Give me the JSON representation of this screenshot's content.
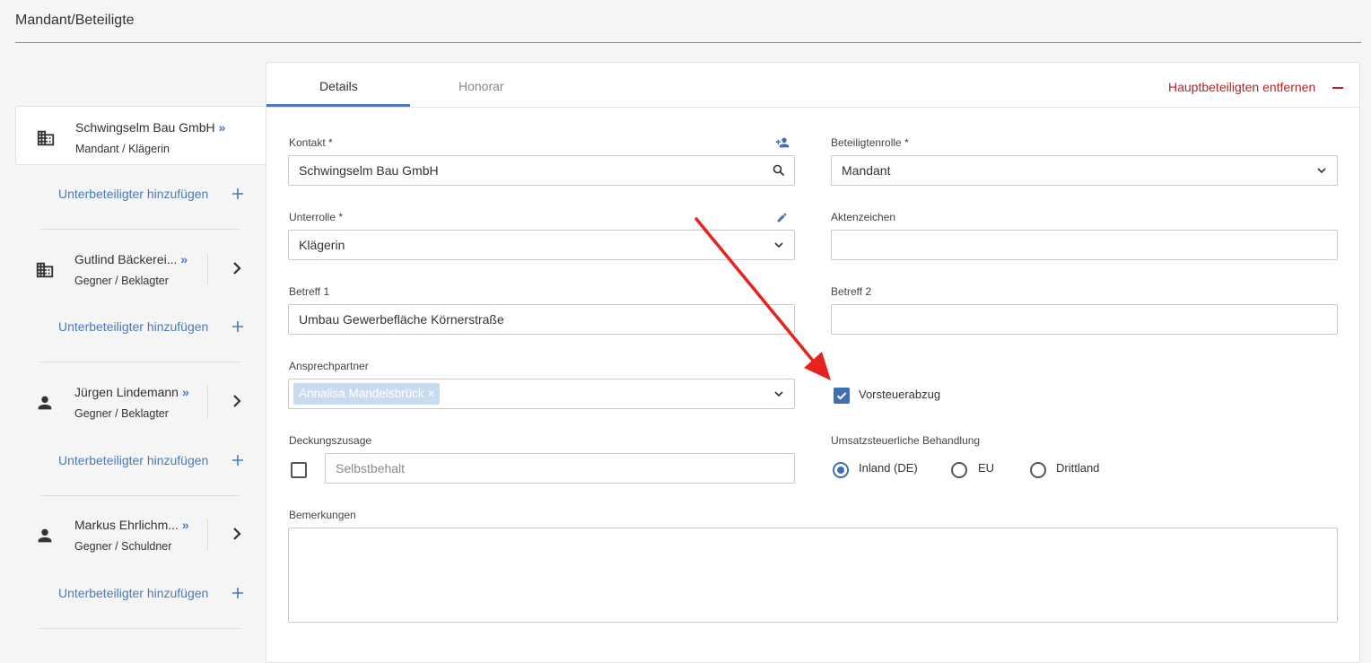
{
  "page": {
    "title": "Mandant/Beteiligte"
  },
  "sidebar": {
    "add_sub_label": "Unterbeteiligter hinzufügen",
    "parties": [
      {
        "name": "Schwingselm Bau GmbH",
        "role": "Mandant / Klägerin",
        "icon": "building-icon",
        "active": true
      },
      {
        "name": "Gutlind Bäckerei...",
        "role": "Gegner / Beklagter",
        "icon": "building-icon",
        "active": false
      },
      {
        "name": "Jürgen Lindemann",
        "role": "Gegner / Beklagter",
        "icon": "person-icon",
        "active": false
      },
      {
        "name": "Markus Ehrlichm...",
        "role": "Gegner / Schuldner",
        "icon": "person-icon",
        "active": false
      }
    ]
  },
  "tabs": [
    {
      "label": "Details",
      "active": true
    },
    {
      "label": "Honorar",
      "active": false
    }
  ],
  "header": {
    "remove_main_label": "Hauptbeteiligten entfernen"
  },
  "form": {
    "kontakt": {
      "label": "Kontakt",
      "required": "*",
      "value": "Schwingselm Bau GmbH"
    },
    "beteiligtenrolle": {
      "label": "Beteiligtenrolle",
      "required": "*",
      "value": "Mandant"
    },
    "unterrolle": {
      "label": "Unterrolle",
      "required": "*",
      "value": "Klägerin"
    },
    "aktenzeichen": {
      "label": "Aktenzeichen",
      "value": ""
    },
    "betreff1": {
      "label": "Betreff 1",
      "value": "Umbau Gewerbefläche Körnerstraße"
    },
    "betreff2": {
      "label": "Betreff 2",
      "value": ""
    },
    "ansprechpartner": {
      "label": "Ansprechpartner",
      "chip": "Annalisa Mandelsbrück",
      "chip_remove": "×"
    },
    "vorsteuerabzug": {
      "label": "Vorsteuerabzug",
      "checked": true
    },
    "deckungszusage": {
      "label": "Deckungszusage",
      "checked": false,
      "placeholder": "Selbstbehalt"
    },
    "umsatzsteuer": {
      "label": "Umsatzsteuerliche Behandlung",
      "options": [
        "Inland (DE)",
        "EU",
        "Drittland"
      ],
      "selected": "Inland (DE)"
    },
    "bemerkungen": {
      "label": "Bemerkungen",
      "value": ""
    }
  },
  "colors": {
    "accent": "#4a7ab8",
    "danger": "#b52525",
    "chip": "#c9dcef",
    "annotation_arrow": "#e8231f"
  }
}
